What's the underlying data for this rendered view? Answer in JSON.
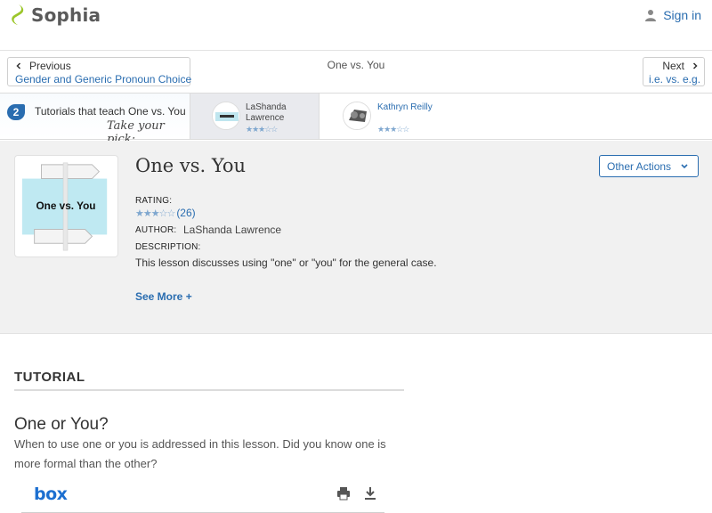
{
  "header": {
    "brand": "Sophia",
    "brand_color": "#9cc62a",
    "signin_label": "Sign in"
  },
  "nav": {
    "prev_label": "Previous",
    "prev_link": "Gender and Generic Pronoun Choice",
    "current_title": "One vs. You",
    "next_label": "Next",
    "next_link": "i.e. vs. e.g."
  },
  "tutorials_bar": {
    "count": "2",
    "text": "Tutorials that teach One vs. You",
    "pick": "Take your pick:",
    "cards": [
      {
        "author_line1": "LaShanda",
        "author_line2": "Lawrence",
        "stars": "★★★☆☆",
        "active": true
      },
      {
        "author_line1": "Kathryn Reilly",
        "author_line2": "",
        "stars": "★★★☆☆",
        "active": false
      }
    ]
  },
  "lesson": {
    "title": "One vs. You",
    "thumbnail_text": "One vs. You",
    "actions_label": "Other Actions",
    "rating_label": "RATING:",
    "rating_stars": "★★★☆☆",
    "rating_count": "(26)",
    "author_label": "AUTHOR:",
    "author": "LaShanda Lawrence",
    "description_label": "DESCRIPTION:",
    "description": "This lesson discusses using \"one\" or \"you\" for the general case.",
    "see_more": "See More +"
  },
  "tutorial": {
    "section_label": "TUTORIAL",
    "heading": "One or You?",
    "description": "When to use one or you is addressed in this lesson. Did you know one is more formal than the other?",
    "embed_brand": "box"
  }
}
